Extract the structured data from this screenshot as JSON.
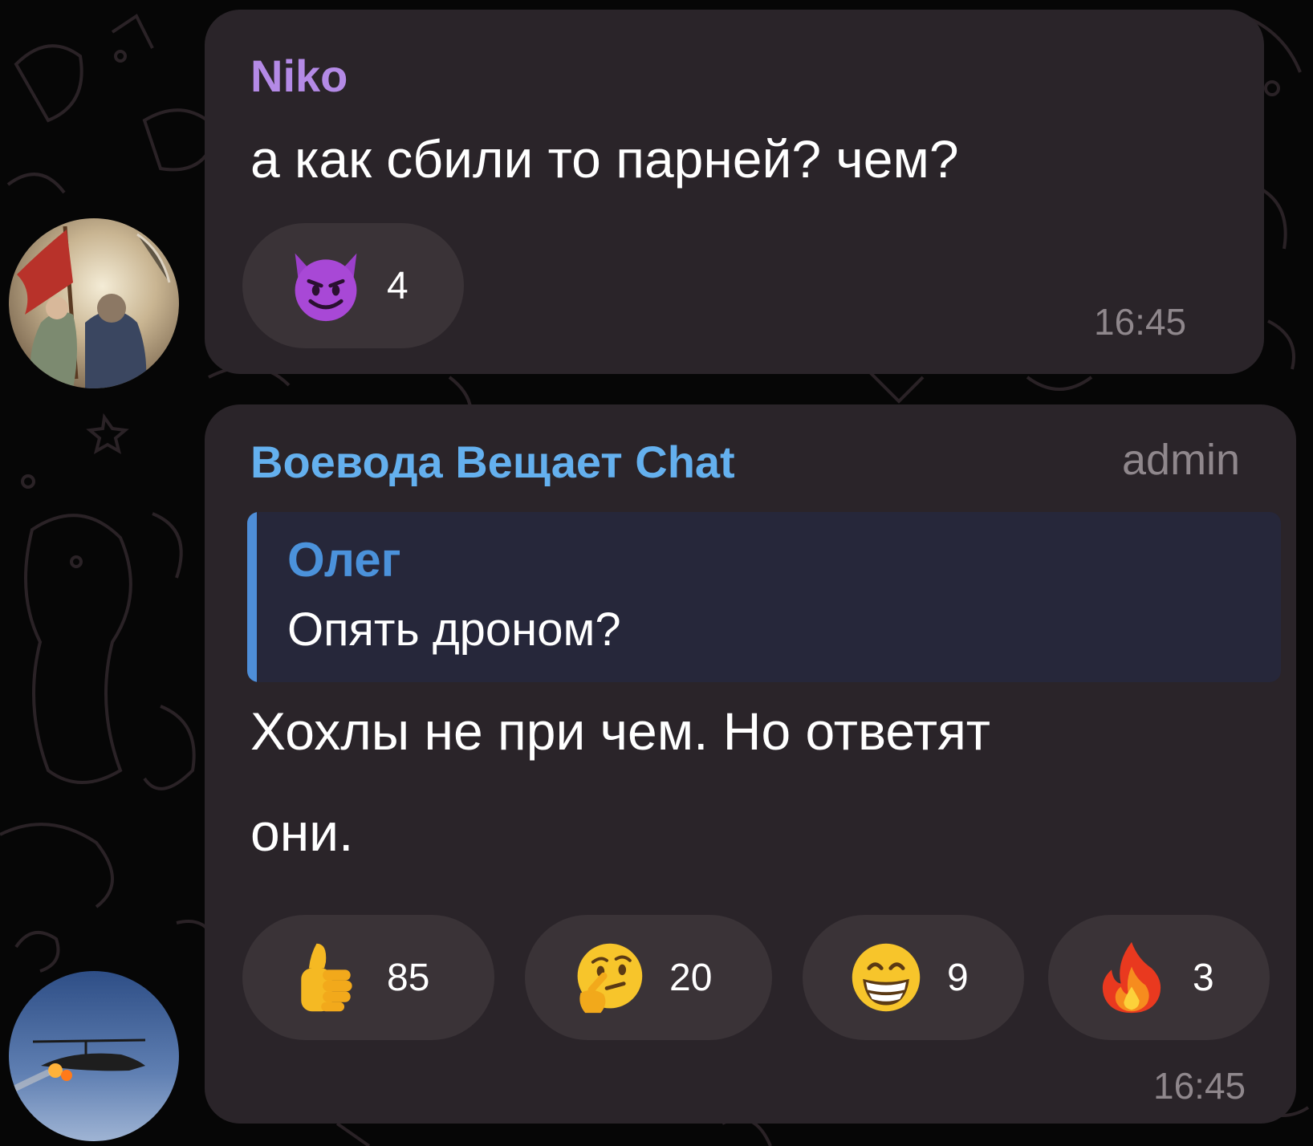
{
  "messages": [
    {
      "sender": "Niko",
      "sender_color": "#b48ae6",
      "text_lines": [
        "а как сбили то парней? чем?"
      ],
      "reactions": [
        {
          "emoji": "smiling-imp-emoji",
          "count": "4"
        }
      ],
      "time": "16:45"
    },
    {
      "sender": "Воевода Вещает Chat",
      "sender_color": "#64b0ee",
      "badge": "admin",
      "reply": {
        "author": "Олег",
        "text": "Опять дроном?"
      },
      "text_lines": [
        "Хохлы не при чем. Но ответят",
        "они."
      ],
      "reactions": [
        {
          "emoji": "thumbs-up-emoji",
          "count": "85"
        },
        {
          "emoji": "thinking-face-emoji",
          "count": "20"
        },
        {
          "emoji": "grinning-face-emoji",
          "count": "9"
        },
        {
          "emoji": "fire-emoji",
          "count": "3"
        }
      ],
      "time": "16:45"
    }
  ],
  "colors": {
    "background": "#060606",
    "bubble": "#2a2429",
    "reaction_pill": "#3a3337",
    "reply_bar": "#4e8ed8",
    "reply_background": "#26273a",
    "timestamp": "#8f878c"
  }
}
